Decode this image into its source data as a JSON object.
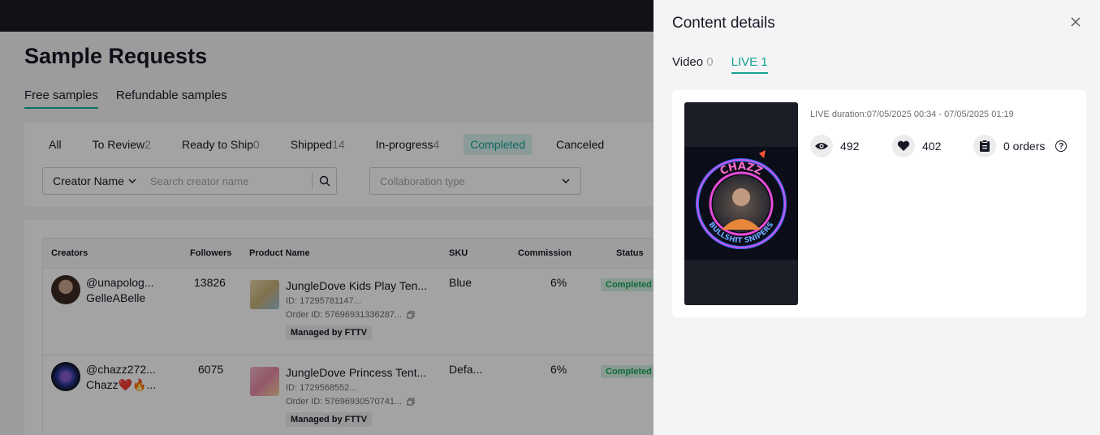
{
  "page": {
    "title": "Sample Requests",
    "sample_tabs": [
      "Free samples",
      "Refundable samples"
    ],
    "status_tabs": [
      {
        "label": "All",
        "count": ""
      },
      {
        "label": "To Review",
        "count": "2"
      },
      {
        "label": "Ready to Ship",
        "count": "0"
      },
      {
        "label": "Shipped",
        "count": "14"
      },
      {
        "label": "In-progress",
        "count": "4"
      },
      {
        "label": "Completed",
        "count": ""
      },
      {
        "label": "Canceled",
        "count": ""
      }
    ],
    "creator_select": "Creator Name",
    "search_placeholder": "Search creator name",
    "collab_placeholder": "Collaboration type",
    "table": {
      "headers": [
        "Creators",
        "Followers",
        "Product Name",
        "SKU",
        "Commission",
        "Status"
      ],
      "rows": [
        {
          "handle": "@unapolog...",
          "name": "GelleABelle",
          "followers": "13826",
          "product": "JungleDove Kids Play Ten...",
          "product_id": "ID: 17295781147...",
          "order_id": "Order ID: 57696931336287...",
          "managed": "Managed by FTTV",
          "sku": "Blue",
          "commission": "6%",
          "status": "Completed"
        },
        {
          "handle": "@chazz272...",
          "name": "Chazz❤️🔥...",
          "followers": "6075",
          "product": "JungleDove Princess Tent...",
          "product_id": "ID: 1729568552...",
          "order_id": "Order ID: 57696930570741...",
          "managed": "Managed by FTTV",
          "sku": "Defa...",
          "commission": "6%",
          "status": "Completed"
        }
      ]
    }
  },
  "drawer": {
    "title": "Content details",
    "tabs": [
      {
        "label": "Video",
        "count": "0"
      },
      {
        "label": "LIVE",
        "count": "1"
      }
    ],
    "live": {
      "duration": "LIVE duration:07/05/2025 00:34 - 07/05/2025 01:19",
      "views": "492",
      "likes": "402",
      "orders": "0 orders",
      "thumb_text_top": "CHAZZ",
      "thumb_text_bottom": "BULLSHIT SNIPERS"
    }
  },
  "colors": {
    "accent": "#13a193",
    "topbar": "#1a1d23",
    "completed": "#17a45a"
  }
}
